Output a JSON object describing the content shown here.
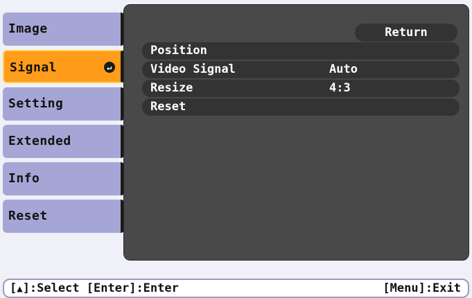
{
  "menu": {
    "items": [
      {
        "label": "Image",
        "active": false
      },
      {
        "label": "Signal",
        "active": true
      },
      {
        "label": "Setting",
        "active": false
      },
      {
        "label": "Extended",
        "active": false
      },
      {
        "label": "Info",
        "active": false
      },
      {
        "label": "Reset",
        "active": false
      }
    ]
  },
  "panel": {
    "return_label": "Return",
    "rows": [
      {
        "label": "Position",
        "value": ""
      },
      {
        "label": "Video Signal",
        "value": "Auto"
      },
      {
        "label": "Resize",
        "value": "4:3"
      },
      {
        "label": "Reset",
        "value": ""
      }
    ]
  },
  "footer": {
    "left_prefix": "[",
    "left_icon": "up-down-arrow-icon",
    "left_rest": "]:Select [Enter]:Enter",
    "right": "[Menu]:Exit"
  },
  "colors": {
    "menu_item": "#a6a6d6",
    "menu_active": "#ff9c1a",
    "panel": "#494949",
    "row": "#333333",
    "background": "#f0f0f8"
  }
}
